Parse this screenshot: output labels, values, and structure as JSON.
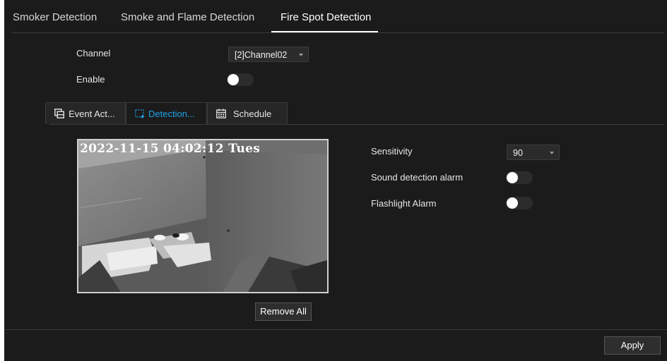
{
  "tabs": [
    {
      "label": "Smoker Detection",
      "active": false
    },
    {
      "label": "Smoke and Flame Detection",
      "active": false
    },
    {
      "label": "Fire Spot Detection",
      "active": true
    }
  ],
  "channel": {
    "label": "Channel",
    "value": "[2]Channel02"
  },
  "enable": {
    "label": "Enable",
    "on": false
  },
  "sub_tabs": [
    {
      "label": "Event Act...",
      "icon": "event-action-icon",
      "active": false
    },
    {
      "label": "Detection...",
      "icon": "detection-area-icon",
      "active": true
    },
    {
      "label": "Schedule",
      "icon": "calendar-icon",
      "active": false
    }
  ],
  "video": {
    "timestamp": "2022-11-15 04:02:12 Tues"
  },
  "remove_all_label": "Remove All",
  "settings": {
    "sensitivity": {
      "label": "Sensitivity",
      "value": "90"
    },
    "sound_alarm": {
      "label": "Sound detection alarm",
      "on": false
    },
    "flashlight_alarm": {
      "label": "Flashlight Alarm",
      "on": false
    }
  },
  "apply_label": "Apply",
  "colors": {
    "accent": "#1da4e6",
    "background": "#1b1b1b",
    "text": "#e6e6e6"
  }
}
